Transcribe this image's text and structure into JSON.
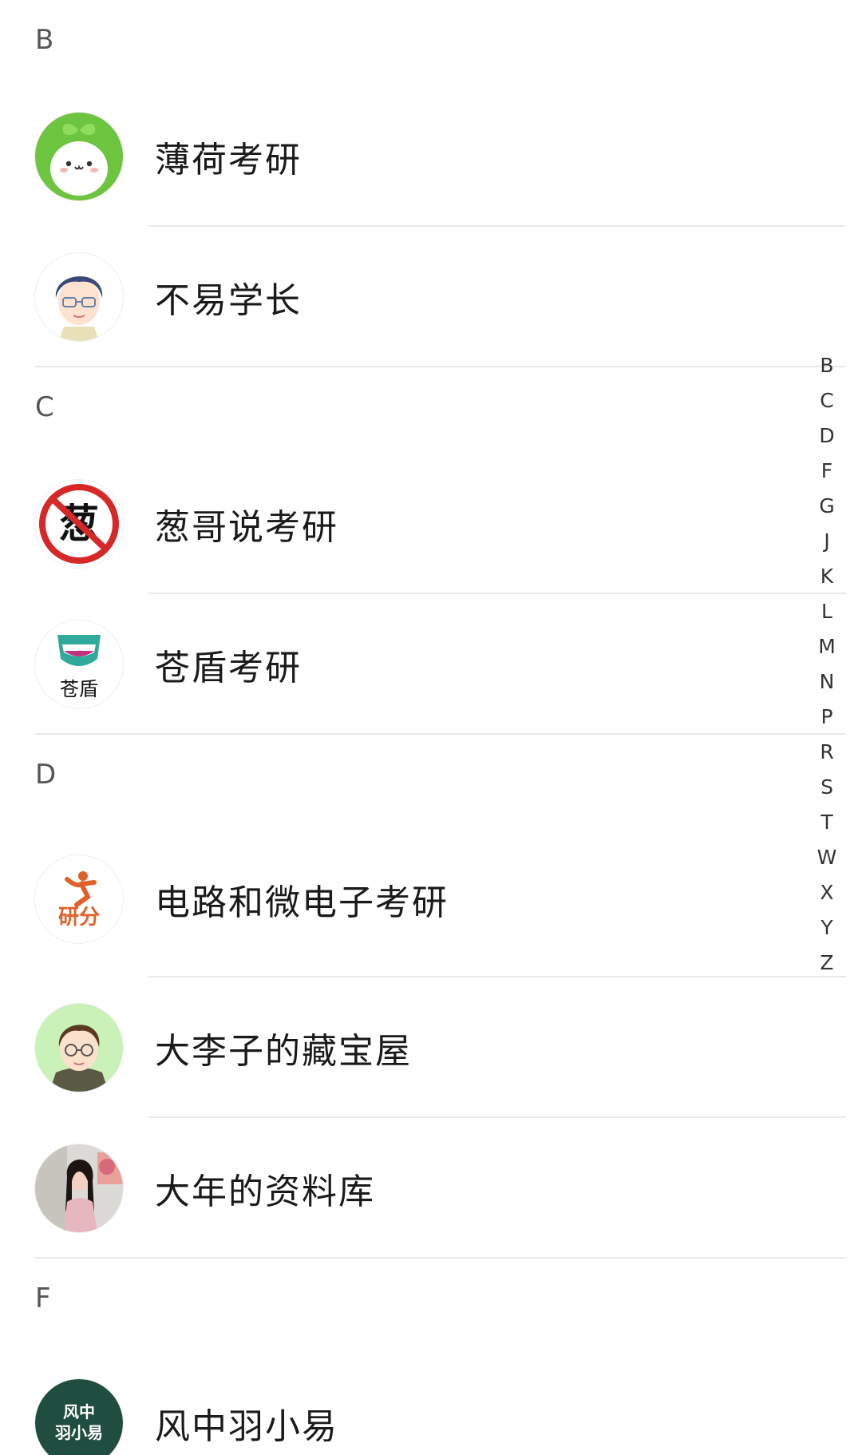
{
  "sections": [
    {
      "letter": "B",
      "contacts": [
        {
          "name": "薄荷考研",
          "avatar_icon": "green-sprout-mascot-avatar"
        },
        {
          "name": "不易学长",
          "avatar_icon": "cartoon-boy-glasses-avatar"
        }
      ]
    },
    {
      "letter": "C",
      "contacts": [
        {
          "name": "葱哥说考研",
          "avatar_icon": "no-onion-sign-avatar",
          "avatar_text": "葱"
        },
        {
          "name": "苍盾考研",
          "avatar_icon": "shield-logo-avatar",
          "avatar_text": "苍盾"
        }
      ]
    },
    {
      "letter": "D",
      "contacts": [
        {
          "name": "电路和微电子考研",
          "avatar_icon": "running-figure-logo-avatar",
          "avatar_text": "研分"
        },
        {
          "name": "大李子的藏宝屋",
          "avatar_icon": "cartoon-boy-round-glasses-avatar"
        },
        {
          "name": "大年的资料库",
          "avatar_icon": "woman-photo-avatar"
        }
      ]
    },
    {
      "letter": "F",
      "contacts": [
        {
          "name": "风中羽小易",
          "avatar_icon": "text-logo-avatar",
          "avatar_text_line1": "风中",
          "avatar_text_line2": "羽小易"
        }
      ]
    }
  ],
  "index_bar": [
    "B",
    "C",
    "D",
    "F",
    "G",
    "J",
    "K",
    "L",
    "M",
    "N",
    "P",
    "R",
    "S",
    "T",
    "W",
    "X",
    "Y",
    "Z"
  ],
  "colors": {
    "background": "#ffffff",
    "divider": "#e9e9e9",
    "header_text": "#555555",
    "name_text": "#1a1a1a",
    "mint_green": "#6cc43f",
    "no_sign_red": "#d62828",
    "shield_teal": "#2fa99a",
    "logo_orange": "#e0602a",
    "dark_green_logo": "#1f4d3f"
  }
}
